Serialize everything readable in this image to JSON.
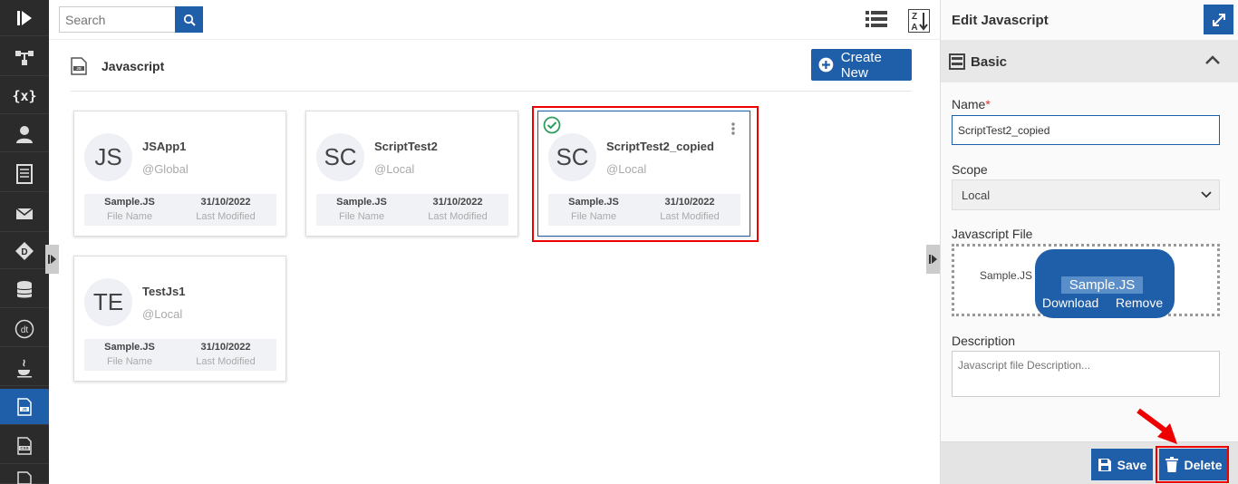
{
  "search": {
    "placeholder": "Search"
  },
  "page": {
    "title": "Javascript",
    "create_label": "Create New"
  },
  "cards": [
    {
      "initials": "JS",
      "name": "JSApp1",
      "scope": "@Global",
      "file": "Sample.JS",
      "file_label": "File Name",
      "date": "31/10/2022",
      "date_label": "Last Modified"
    },
    {
      "initials": "SC",
      "name": "ScriptTest2",
      "scope": "@Local",
      "file": "Sample.JS",
      "file_label": "File Name",
      "date": "31/10/2022",
      "date_label": "Last Modified"
    },
    {
      "initials": "SC",
      "name": "ScriptTest2_copied",
      "scope": "@Local",
      "file": "Sample.JS",
      "file_label": "File Name",
      "date": "31/10/2022",
      "date_label": "Last Modified",
      "selected": true
    },
    {
      "initials": "TE",
      "name": "TestJs1",
      "scope": "@Local",
      "file": "Sample.JS",
      "file_label": "File Name",
      "date": "31/10/2022",
      "date_label": "Last Modified"
    }
  ],
  "sidebar_icons": [
    "logo-icon",
    "flow-icon",
    "variables-icon",
    "user-icon",
    "document-icon",
    "mail-icon",
    "decision-icon",
    "database-icon",
    "datatable-icon",
    "java-icon",
    "javascript-icon",
    "css-icon",
    "file-icon"
  ],
  "panel": {
    "title": "Edit Javascript",
    "section": "Basic",
    "name_label": "Name",
    "required_mark": "*",
    "name_value": "ScriptTest2_copied",
    "scope_label": "Scope",
    "scope_value": "Local",
    "file_label": "Javascript File",
    "file_name": "Sample.JS",
    "file_popup_name": "Sample.JS",
    "download_label": "Download",
    "remove_label": "Remove",
    "desc_label": "Description",
    "desc_placeholder": "Javascript file Description...",
    "save_label": "Save",
    "delete_label": "Delete"
  },
  "colors": {
    "primary": "#1f5ea8",
    "sidebar": "#2b2b2b",
    "highlight": "#e00000",
    "check": "#2e9e5b"
  }
}
